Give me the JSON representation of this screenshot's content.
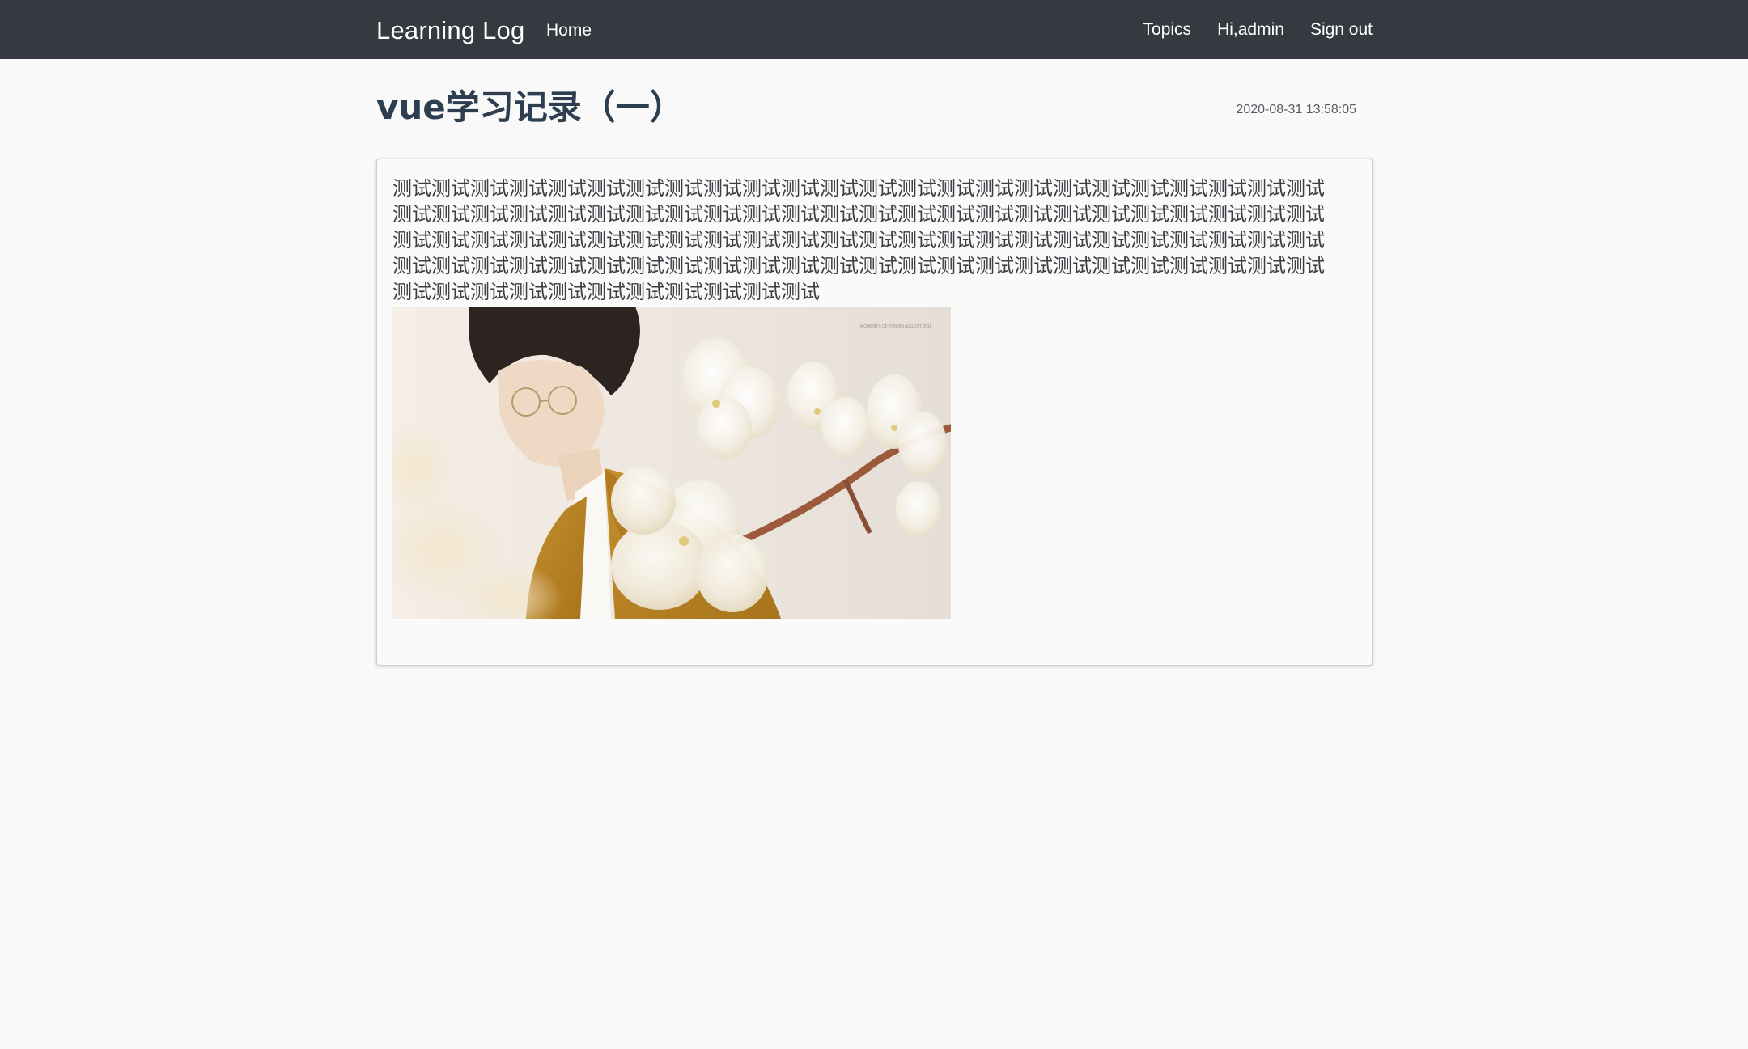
{
  "navbar": {
    "brand": "Learning Log",
    "home": "Home",
    "topics": "Topics",
    "user": "Hi,admin",
    "signout": "Sign out",
    "background": "#343a40"
  },
  "entry": {
    "title": "vue学习记录（一）",
    "timestamp": "2020-08-31 13:58:05",
    "body": "测试测试测试测试测试测试测试测试测试测试测试测试测试测试测试测试测试测试测试测试测试测试测试测试测试测试测试测试测试测试测试测试测试测试测试测试测试测试测试测试测试测试测试测试测试测试测试测试测试测试测试测试测试测试测试测试测试测试测试测试测试测试测试测试测试测试测试测试测试测试测试测试测试测试测试测试测试测试测试测试测试测试测试测试测试测试测试测试测试测试测试测试测试测试测试测试测试测试测试测试测试测试测试测试测试测试测试",
    "image_caption": "MOMENTS OF TOSHIN AUGUST 2018"
  }
}
